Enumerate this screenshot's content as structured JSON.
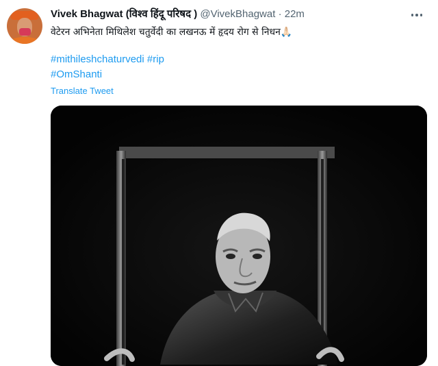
{
  "tweet": {
    "author_name": "Vivek Bhagwat (विश्व हिंदू परिषद )",
    "handle": "@VivekBhagwat",
    "separator": "·",
    "time": "22m",
    "text": "वेटेरन अभिनेता मिथिलेश चतुर्वेदी का लखनऊ में हृदय रोग से निधन",
    "emoji": "🙏🏻",
    "hashtags": [
      "#mithileshchaturvedi",
      "#rip",
      "#OmShanti"
    ],
    "translate_label": "Translate Tweet",
    "more_icon": "more-horizontal-icon",
    "avatar_icon": "profile-avatar",
    "media": {
      "type": "black-and-white photo"
    }
  },
  "colors": {
    "name": "#0f1419",
    "meta": "#536471",
    "link": "#1d9bf0",
    "media_background": "#070707"
  }
}
